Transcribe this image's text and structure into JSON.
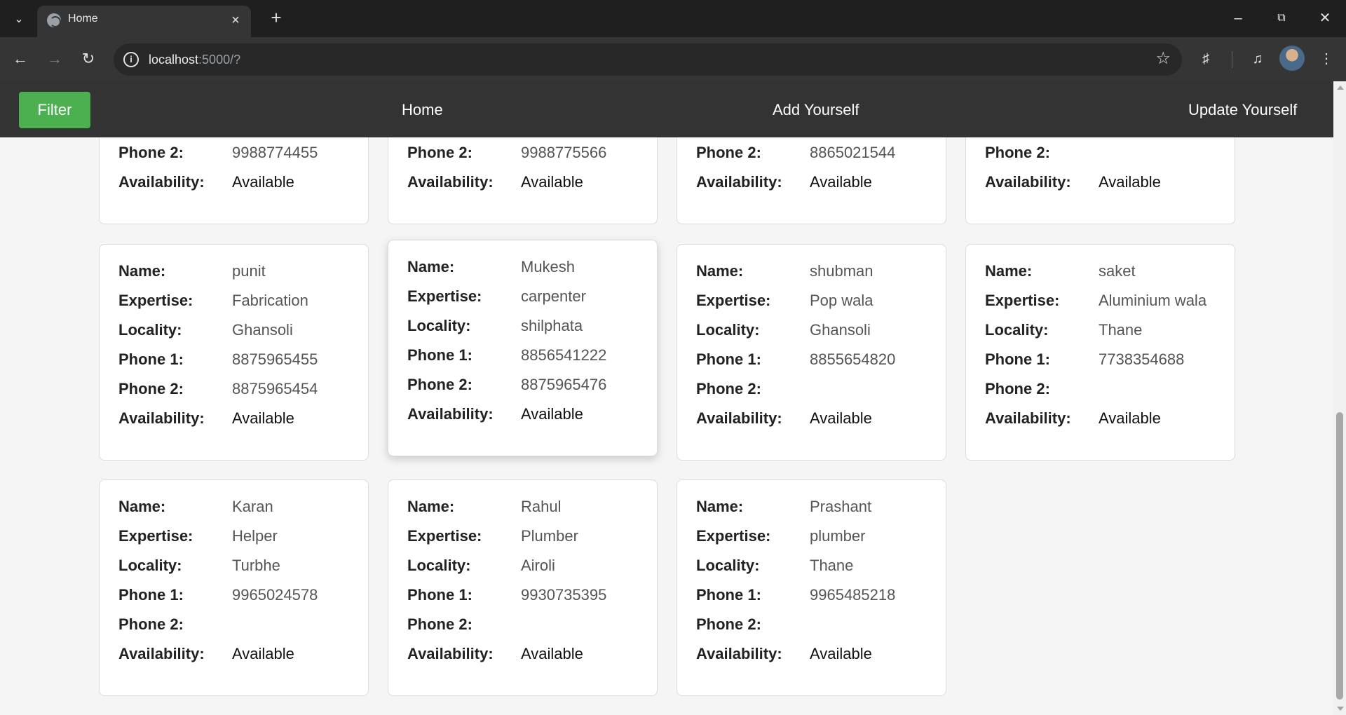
{
  "browser": {
    "tab_title": "Home",
    "url_host": "localhost",
    "url_rest": ":5000/?"
  },
  "navbar": {
    "filter_label": "Filter",
    "links": [
      "Home",
      "Add Yourself",
      "Update Yourself"
    ]
  },
  "labels": {
    "name": "Name:",
    "expertise": "Expertise:",
    "locality": "Locality:",
    "phone1": "Phone 1:",
    "phone2": "Phone 2:",
    "availability": "Availability:"
  },
  "cards_top_partial": [
    {
      "phone2": "9988774455",
      "availability": "Available"
    },
    {
      "phone2": "9988775566",
      "availability": "Available"
    },
    {
      "phone2": "8865021544",
      "availability": "Available"
    },
    {
      "phone2": "",
      "availability": "Available"
    }
  ],
  "cards": [
    {
      "name": "punit",
      "expertise": "Fabrication",
      "locality": "Ghansoli",
      "phone1": "8875965455",
      "phone2": "8875965454",
      "availability": "Available"
    },
    {
      "name": "Mukesh",
      "expertise": "carpenter",
      "locality": "shilphata",
      "phone1": "8856541222",
      "phone2": "8875965476",
      "availability": "Available"
    },
    {
      "name": "shubman",
      "expertise": "Pop wala",
      "locality": "Ghansoli",
      "phone1": "8855654820",
      "phone2": "",
      "availability": "Available"
    },
    {
      "name": "saket",
      "expertise": "Aluminium wala",
      "locality": "Thane",
      "phone1": "7738354688",
      "phone2": "",
      "availability": "Available"
    },
    {
      "name": "Karan",
      "expertise": "Helper",
      "locality": "Turbhe",
      "phone1": "9965024578",
      "phone2": "",
      "availability": "Available"
    },
    {
      "name": "Rahul",
      "expertise": "Plumber",
      "locality": "Airoli",
      "phone1": "9930735395",
      "phone2": "",
      "availability": "Available"
    },
    {
      "name": "Prashant",
      "expertise": "plumber",
      "locality": "Thane",
      "phone1": "9965485218",
      "phone2": "",
      "availability": "Available"
    }
  ]
}
